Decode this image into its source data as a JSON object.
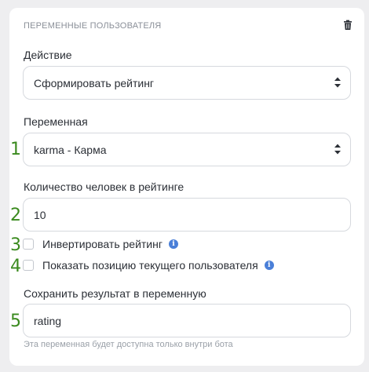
{
  "section": {
    "title": "ПЕРЕМЕННЫЕ ПОЛЬЗОВАТЕЛЯ",
    "delete_icon": "trash-icon"
  },
  "action": {
    "label": "Действие",
    "value": "Сформировать рейтинг"
  },
  "variable": {
    "number": "1",
    "label": "Переменная",
    "value": "karma - Карма"
  },
  "count": {
    "number": "2",
    "label": "Количество человек в рейтинге",
    "value": "10"
  },
  "invert": {
    "number": "3",
    "label": "Инвертировать рейтинг",
    "checked": false,
    "info_icon": "info-icon"
  },
  "show_position": {
    "number": "4",
    "label": "Показать позицию текущего пользователя",
    "checked": false,
    "info_icon": "info-icon"
  },
  "save_result": {
    "number": "5",
    "label": "Сохранить результат в переменную",
    "value": "rating",
    "hint": "Эта переменная будет доступна только внутри бота"
  },
  "colors": {
    "annotation_numbers": "#3a8a1e",
    "info_icon": "#4a7fd8"
  }
}
